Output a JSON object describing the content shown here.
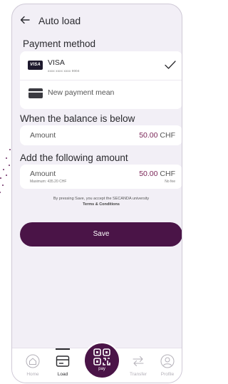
{
  "header": {
    "title": "Auto load"
  },
  "payment_method": {
    "title": "Payment method",
    "cards": [
      {
        "brand": "VISA",
        "name": "VISA",
        "number": "xxxx xxxx xxxx 0004",
        "selected": true
      }
    ],
    "new_label": "New payment mean"
  },
  "balance_below": {
    "title": "When the balance is below",
    "label": "Amount",
    "value": "50.00",
    "currency": "CHF"
  },
  "add_amount": {
    "title": "Add the following amount",
    "label": "Amount",
    "maximum": "Maximum: 435.20 CHF",
    "value": "50.00",
    "currency": "CHF",
    "fee": "No fee"
  },
  "disclaimer": {
    "text": "By pressing Save, you accept the SECANDA university",
    "link": "Terms & Conditions"
  },
  "save_label": "Save",
  "nav": {
    "home": "Home",
    "load": "Load",
    "pay": "pay",
    "transfer": "Transfer",
    "profile": "Profile",
    "active": "load"
  },
  "colors": {
    "accent": "#4a1447",
    "value": "#7b2658",
    "background": "#f2eff6"
  }
}
